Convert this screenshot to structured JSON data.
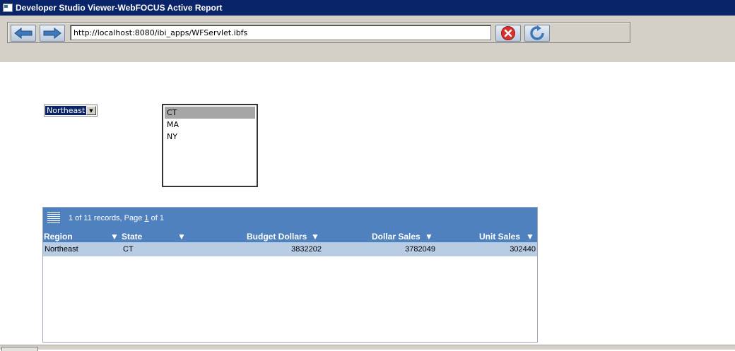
{
  "window": {
    "title": "Developer Studio Viewer-WebFOCUS Active Report"
  },
  "toolbar": {
    "url": "http://localhost:8080/ibi_apps/WFServlet.ibfs",
    "icons": [
      "back-arrow-icon",
      "forward-arrow-icon",
      "stop-icon",
      "refresh-icon"
    ]
  },
  "filters": {
    "region_selected": "Northeast",
    "states": [
      "CT",
      "MA",
      "NY"
    ],
    "state_selected": "CT"
  },
  "report": {
    "records_prefix": "1 of 11 records, Page ",
    "page_current": "1",
    "records_suffix": " of 1",
    "columns": [
      "Region",
      "State",
      "Budget Dollars",
      "Dollar Sales",
      "Unit Sales"
    ],
    "rows": [
      {
        "region": "Northeast",
        "state": "CT",
        "budget_dollars": "3832202",
        "dollar_sales": "3782049",
        "unit_sales": "302440"
      }
    ],
    "header_color": "#4e81bd",
    "row_color": "#b8cce4"
  }
}
